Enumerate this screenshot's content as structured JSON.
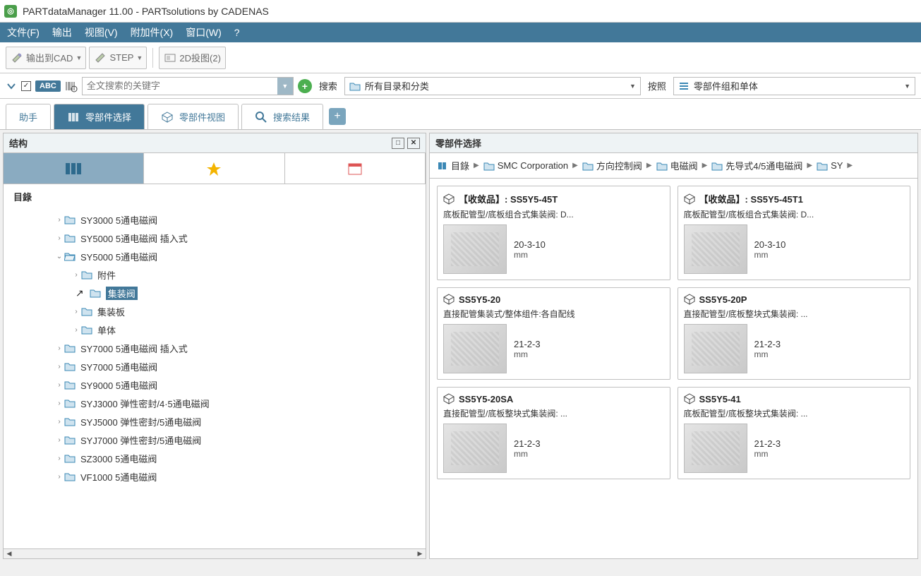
{
  "window": {
    "title": "PARTdataManager 11.00 - PARTsolutions by CADENAS"
  },
  "menubar": [
    "文件(F)",
    "输出",
    "视图(V)",
    "附加件(X)",
    "窗口(W)",
    "?"
  ],
  "toolbar1": {
    "cad_export": "输出到CAD",
    "step": "STEP",
    "proj2d": "2D投图(2)"
  },
  "toolbar2": {
    "abc": "ABC",
    "search_placeholder": "全文搜索的关键字",
    "search_label": "搜索",
    "scope_value": "所有目录和分类",
    "by_label": "按照",
    "by_value": "零部件组和单体"
  },
  "tabs": {
    "assistant": "助手",
    "part_select": "零部件选择",
    "part_view": "零部件视图",
    "search_results": "搜索结果"
  },
  "left_panel": {
    "header": "结构",
    "catalog_label": "目錄"
  },
  "tree": [
    {
      "indent": 3,
      "icon": "folder",
      "label": "SY3000 5通电磁阀",
      "twist": "right"
    },
    {
      "indent": 3,
      "icon": "folder",
      "label": "SY5000 5通电磁阀 插入式",
      "twist": "right"
    },
    {
      "indent": 3,
      "icon": "folder-open",
      "label": "SY5000 5通电磁阀",
      "twist": "down"
    },
    {
      "indent": 4,
      "icon": "folder",
      "label": "附件",
      "twist": "right"
    },
    {
      "indent": 4,
      "icon": "folder",
      "label": "集装阀",
      "twist": "",
      "selected": true,
      "cursor": true
    },
    {
      "indent": 4,
      "icon": "folder",
      "label": "集装板",
      "twist": "right"
    },
    {
      "indent": 4,
      "icon": "folder",
      "label": "单体",
      "twist": "right"
    },
    {
      "indent": 3,
      "icon": "folder",
      "label": "SY7000 5通电磁阀 插入式",
      "twist": "right"
    },
    {
      "indent": 3,
      "icon": "folder",
      "label": "SY7000 5通电磁阀",
      "twist": "right"
    },
    {
      "indent": 3,
      "icon": "folder",
      "label": "SY9000 5通电磁阀",
      "twist": "right"
    },
    {
      "indent": 3,
      "icon": "folder",
      "label": "SYJ3000 弹性密封/4·5通电磁阀",
      "twist": "right"
    },
    {
      "indent": 3,
      "icon": "folder",
      "label": "SYJ5000 弹性密封/5通电磁阀",
      "twist": "right"
    },
    {
      "indent": 3,
      "icon": "folder",
      "label": "SYJ7000 弹性密封/5通电磁阀",
      "twist": "right"
    },
    {
      "indent": 3,
      "icon": "folder",
      "label": "SZ3000 5通电磁阀",
      "twist": "right"
    },
    {
      "indent": 3,
      "icon": "folder",
      "label": "VF1000 5通电磁阀",
      "twist": "right"
    }
  ],
  "right_panel": {
    "header": "零部件选择"
  },
  "breadcrumb": [
    {
      "icon": "book",
      "label": "目錄"
    },
    {
      "icon": "folder",
      "label": "SMC Corporation"
    },
    {
      "icon": "folder",
      "label": "方向控制阀"
    },
    {
      "icon": "folder",
      "label": "电磁阀"
    },
    {
      "icon": "folder",
      "label": "先导式4/5通电磁阀"
    },
    {
      "icon": "folder",
      "label": "SY"
    }
  ],
  "cards": [
    {
      "title": "【收敛品】: SS5Y5-45T",
      "sub": "底板配管型/底板组合式集装阀: D...",
      "date": "20-3-10",
      "unit": "mm"
    },
    {
      "title": "【收敛品】: SS5Y5-45T1",
      "sub": "底板配管型/底板组合式集装阀: D...",
      "date": "20-3-10",
      "unit": "mm"
    },
    {
      "title": "SS5Y5-20",
      "sub": "直接配管集装式/整体组件:各自配线",
      "date": "21-2-3",
      "unit": "mm"
    },
    {
      "title": "SS5Y5-20P",
      "sub": "直接配管型/底板整块式集装阀: ...",
      "date": "21-2-3",
      "unit": "mm"
    },
    {
      "title": "SS5Y5-20SA",
      "sub": "直接配管型/底板整块式集装阀: ...",
      "date": "21-2-3",
      "unit": "mm"
    },
    {
      "title": "SS5Y5-41",
      "sub": "底板配管型/底板整块式集装阀: ...",
      "date": "21-2-3",
      "unit": "mm"
    }
  ]
}
